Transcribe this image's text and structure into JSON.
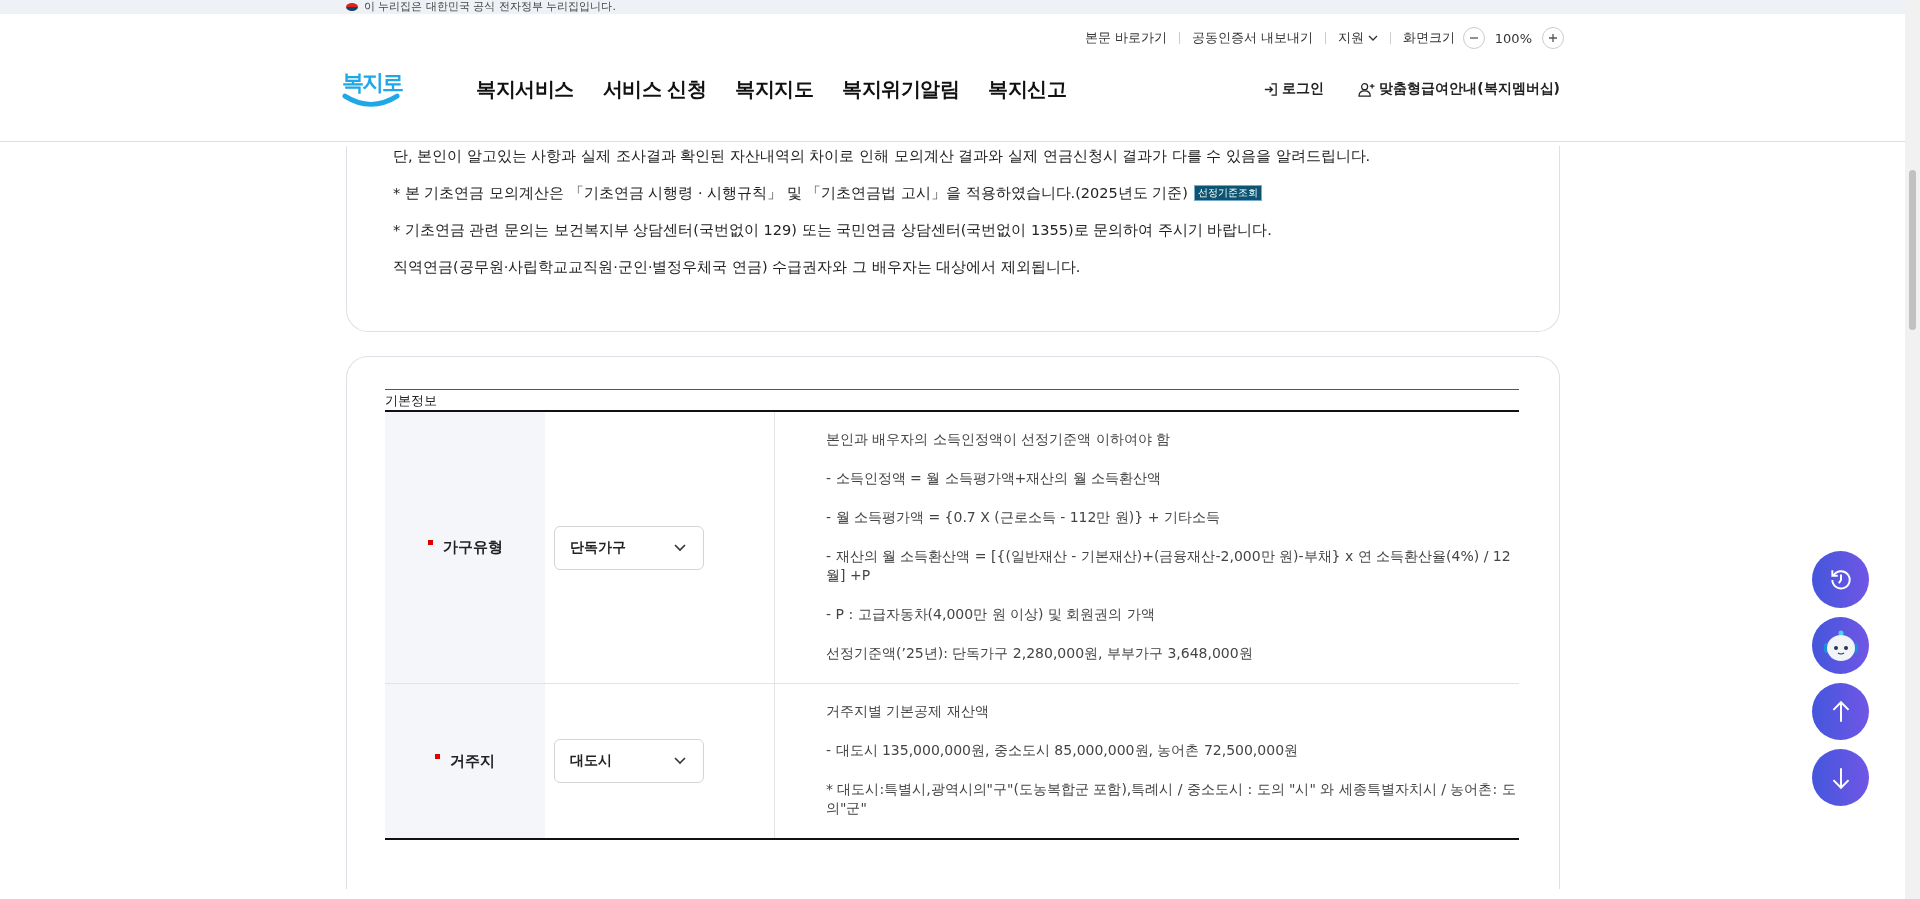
{
  "gov_banner": {
    "text": "이 누리집은 대한민국 공식 전자정부 누리집입니다."
  },
  "utility_links": [
    {
      "label": "본문 바로가기",
      "kind": "link"
    },
    {
      "label": "공동인증서 내보내기",
      "kind": "link"
    },
    {
      "label": "지원",
      "kind": "dropdown"
    }
  ],
  "zoom": {
    "label": "화면크기",
    "value": "100%"
  },
  "logo": {
    "text": "복지로"
  },
  "nav": [
    "복지서비스",
    "서비스 신청",
    "복지지도",
    "복지위기알림",
    "복지신고"
  ],
  "account": [
    {
      "label": "로그인",
      "kind": "login"
    },
    {
      "label": "맞춤형급여안내(복지멤버십)",
      "kind": "member"
    }
  ],
  "notice_lines": [
    {
      "text": "단, 본인이 알고있는 사항과 실제 조사결과 확인된 자산내역의 차이로 인해 모의계산 결과와 실제 연금신청시 결과가 다를 수 있음을 알려드립니다."
    },
    {
      "text": "* 본 기초연금 모의계산은 「기초연금 시행령 · 시행규칙」 및 「기초연금법 고시」을 적용하였습니다.(2025년도 기준)",
      "badge": "선정기준조회"
    },
    {
      "text": "* 기초연금 관련 문의는 보건복지부 상담센터(국번없이 129) 또는 국민연금 상담센터(국번없이 1355)로 문의하여 주시기 바랍니다."
    },
    {
      "text": "직역연금(공무원·사립학교교직원·군인·별정우체국 연금) 수급권자와 그 배우자는 대상에서 제외됩니다."
    }
  ],
  "table": {
    "caption": "기본정보",
    "rows": [
      {
        "label": "가구유형",
        "required": true,
        "value": "단독가구",
        "notes": [
          "본인과 배우자의 소득인정액이 선정기준액 이하여야 함",
          "- 소득인정액 = 월 소득평가액+재산의 월 소득환산액",
          "- 월 소득평가액 = {0.7 X (근로소득 - 112만 원)} + 기타소득",
          "- 재산의 월 소득환산액 = [{(일반재산 - 기본재산)+(금융재산-2,000만 원)-부채} x 연 소득환산율(4%) / 12월] +P",
          "- P : 고급자동차(4,000만 원 이상) 및 회원권의 가액",
          "선정기준액(’25년): 단독가구 2,280,000원, 부부가구 3,648,000원"
        ]
      },
      {
        "label": "거주지",
        "required": true,
        "value": "대도시",
        "notes": [
          "거주지별 기본공제 재산액",
          "- 대도시 135,000,000원, 중소도시 85,000,000원, 농어촌 72,500,000원",
          "* 대도시:특별시,광역시의\"구\"(도농복합군 포함),특례시 / 중소도시 : 도의 \"시\" 와 세종특별자치시 / 농어촌: 도의\"군\""
        ]
      }
    ]
  },
  "floating_buttons": [
    {
      "kind": "history"
    },
    {
      "kind": "chatbot"
    },
    {
      "kind": "top"
    },
    {
      "kind": "bottom"
    }
  ]
}
